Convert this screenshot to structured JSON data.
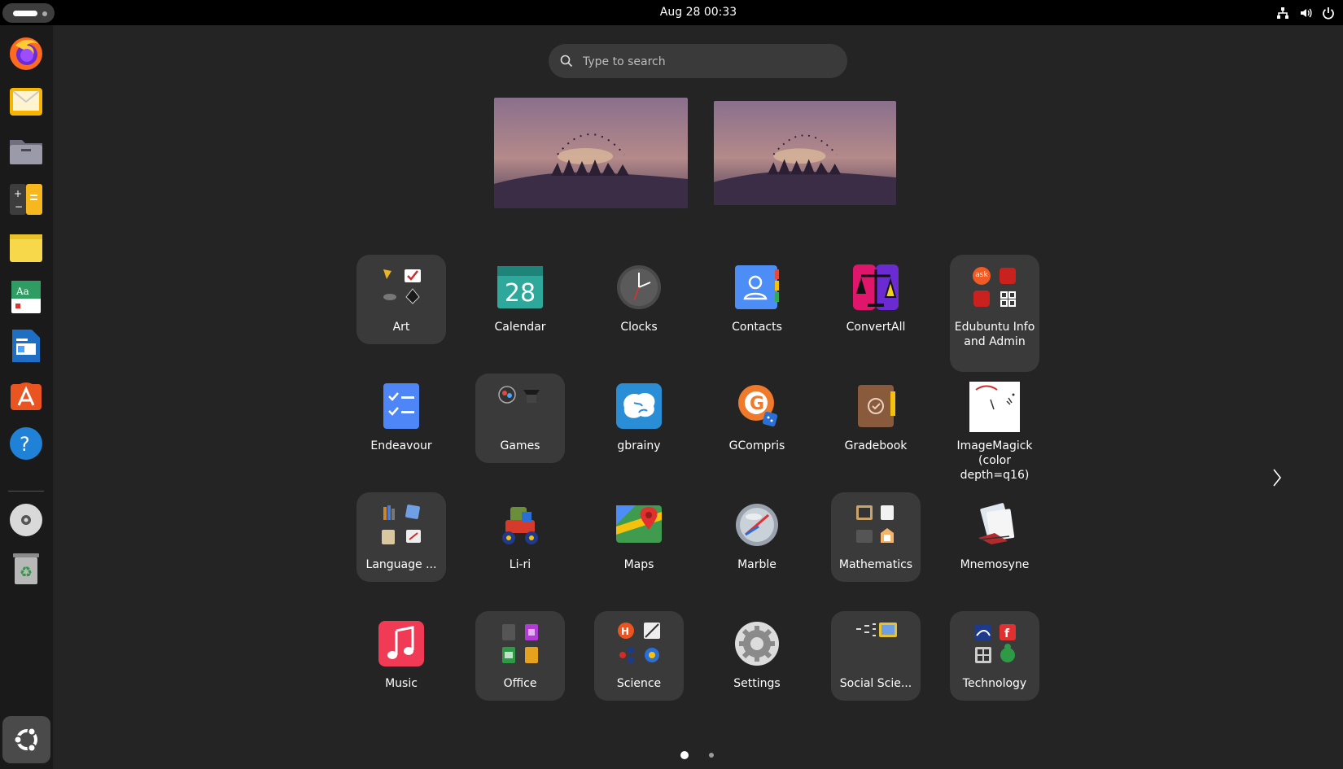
{
  "topbar": {
    "clock": "Aug 28  00:33",
    "tray_icons": [
      "network-icon",
      "volume-icon",
      "power-icon"
    ]
  },
  "dock": {
    "items": [
      {
        "name": "Firefox",
        "icon": "firefox-icon"
      },
      {
        "name": "Thunderbird Mail",
        "icon": "mail-icon"
      },
      {
        "name": "Files",
        "icon": "files-icon"
      },
      {
        "name": "Calculator",
        "icon": "calculator-icon"
      },
      {
        "name": "Sticky Notes",
        "icon": "sticky-notes-icon"
      },
      {
        "name": "Font Viewer",
        "icon": "font-viewer-icon"
      },
      {
        "name": "LibreOffice Writer",
        "icon": "writer-icon"
      },
      {
        "name": "App Center",
        "icon": "app-center-icon"
      },
      {
        "name": "Help",
        "icon": "help-icon"
      },
      {
        "name": "Disc",
        "icon": "disc-icon"
      },
      {
        "name": "Trash",
        "icon": "trash-icon"
      }
    ],
    "show_apps_icon": "ubuntu-logo-icon"
  },
  "search": {
    "placeholder": "Type to search"
  },
  "apps": {
    "row1": [
      "Art",
      "Calendar",
      "Clocks",
      "Contacts",
      "ConvertAll",
      "Edubuntu Info and Admin"
    ],
    "row2": [
      "Endeavour",
      "Games",
      "gbrainy",
      "GCompris",
      "Gradebook",
      "ImageMagick (color depth=q16)"
    ],
    "row3": [
      "Language ...",
      "Li-ri",
      "Maps",
      "Marble",
      "Mathematics",
      "Mnemosyne"
    ],
    "row4": [
      "Music",
      "Office",
      "Science",
      "Settings",
      "Social Scie...",
      "Technology"
    ],
    "calendar_day": "28",
    "edubuntu_ask": "ask"
  },
  "pagination": {
    "pages": 2,
    "current": 1
  },
  "colors": {
    "background": "#242424",
    "topbar": "#000000",
    "dock": "#1a1a1a",
    "folder": "#3a3a3a",
    "accent_orange": "#e95420"
  }
}
